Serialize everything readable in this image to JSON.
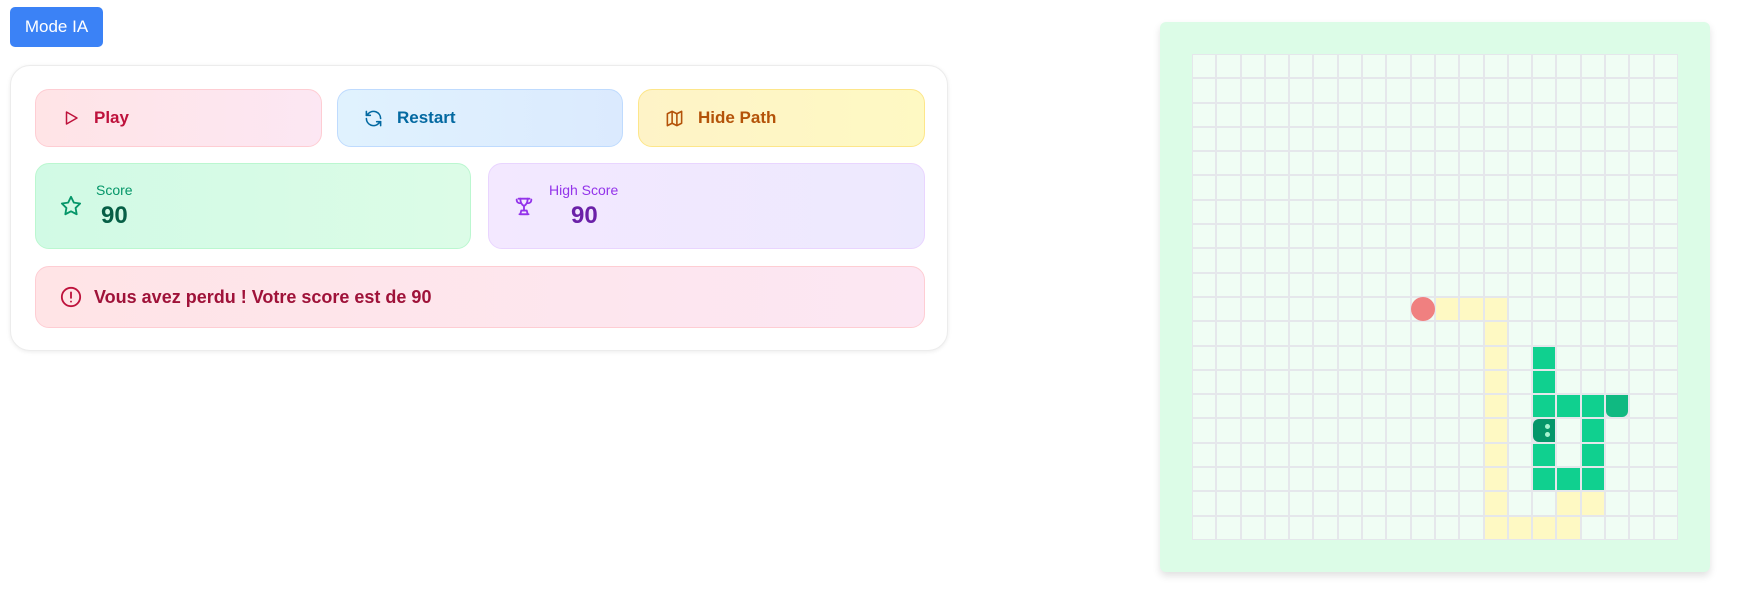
{
  "mode_button": {
    "label": "Mode IA"
  },
  "controls": {
    "play_label": "Play",
    "restart_label": "Restart",
    "path_label": "Hide Path"
  },
  "stats": {
    "score_label": "Score",
    "score_value": "90",
    "high_label": "High Score",
    "high_value": "90"
  },
  "message": {
    "text": "Vous avez perdu ! Votre score est de 90"
  },
  "board": {
    "cols": 20,
    "rows": 20,
    "food": [
      10,
      9
    ],
    "head": [
      15,
      14
    ],
    "snake": [
      [
        14,
        14
      ],
      [
        13,
        14
      ],
      [
        12,
        14
      ],
      [
        14,
        15
      ],
      [
        14,
        16
      ],
      [
        15,
        16
      ],
      [
        16,
        16
      ],
      [
        17,
        16
      ],
      [
        17,
        15
      ],
      [
        16,
        14
      ],
      [
        17,
        14
      ]
    ],
    "tail": [
      [
        14,
        17
      ]
    ],
    "path": [
      [
        10,
        10
      ],
      [
        10,
        11
      ],
      [
        10,
        12
      ],
      [
        11,
        12
      ],
      [
        12,
        12
      ],
      [
        13,
        12
      ],
      [
        14,
        12
      ],
      [
        15,
        12
      ],
      [
        16,
        12
      ],
      [
        17,
        12
      ],
      [
        18,
        12
      ],
      [
        19,
        12
      ],
      [
        19,
        13
      ],
      [
        19,
        14
      ],
      [
        19,
        15
      ],
      [
        18,
        15
      ],
      [
        18,
        16
      ]
    ]
  },
  "icons": {
    "play": "play-icon",
    "restart": "restart-icon",
    "path": "map-icon",
    "score": "star-icon",
    "high": "trophy-icon",
    "alert": "alert-icon"
  }
}
